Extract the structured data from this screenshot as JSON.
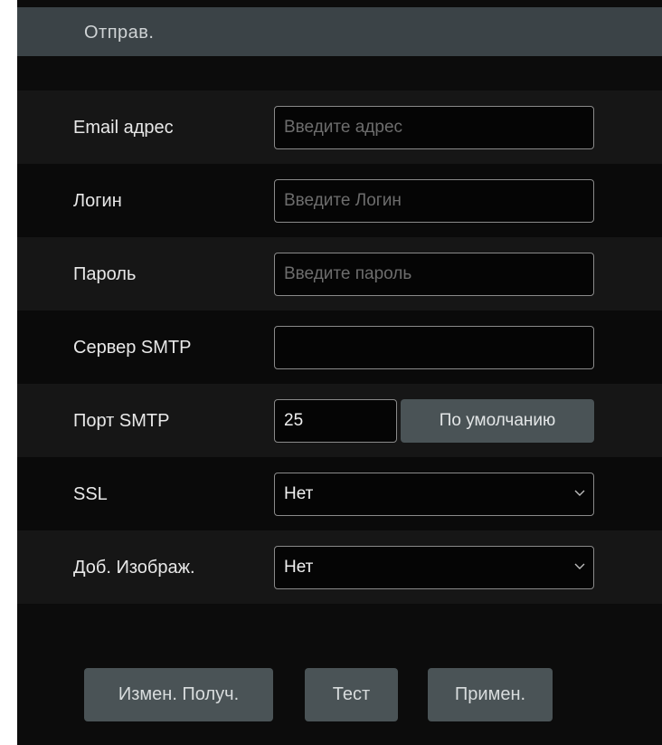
{
  "tab": {
    "label": "Отправ."
  },
  "form": {
    "email": {
      "label": "Email адрес",
      "placeholder": "Введите адрес",
      "value": ""
    },
    "login": {
      "label": "Логин",
      "placeholder": "Введите Логин",
      "value": ""
    },
    "password": {
      "label": "Пароль",
      "placeholder": "Введите пароль",
      "value": ""
    },
    "smtp_server": {
      "label": "Сервер SMTP",
      "placeholder": "",
      "value": ""
    },
    "smtp_port": {
      "label": "Порт SMTP",
      "value": "25",
      "default_button": "По умолчанию"
    },
    "ssl": {
      "label": "SSL",
      "value": "Нет",
      "icon": "chevron-down-icon"
    },
    "attach_image": {
      "label": "Доб. Изображ.",
      "value": "Нет",
      "icon": "chevron-down-icon"
    }
  },
  "actions": {
    "change_recipients": "Измен. Получ.",
    "test": "Тест",
    "apply": "Примен."
  },
  "colors": {
    "background": "#0c0c0c",
    "tab_bar": "#3b4347",
    "button": "#4a5356",
    "input_border": "#8a8a8a"
  }
}
